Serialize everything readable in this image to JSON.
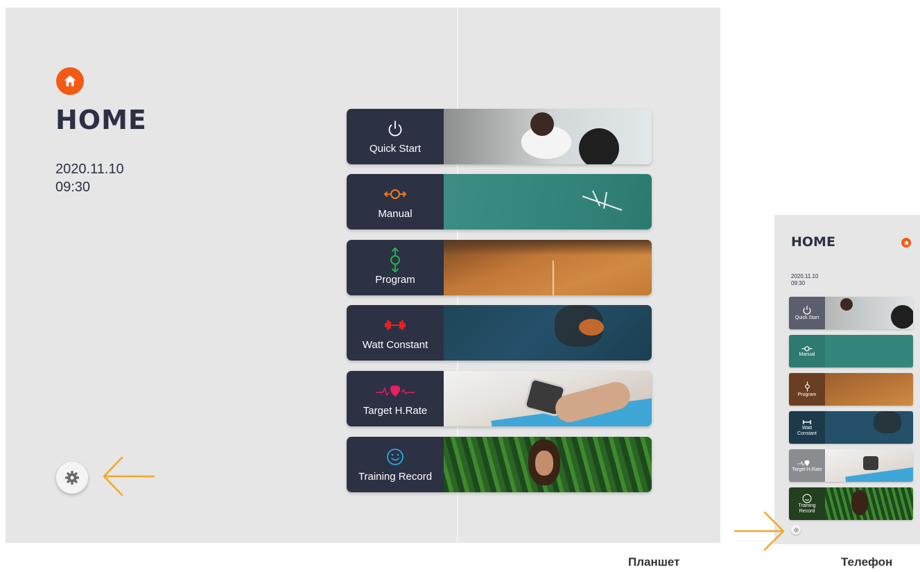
{
  "tablet": {
    "title": "HOME",
    "date": "2020.11.10",
    "time": "09:30",
    "home_icon": "home-icon",
    "settings_icon": "gear-icon",
    "menu": [
      {
        "label": "Quick Start",
        "icon": "power-icon"
      },
      {
        "label": "Manual",
        "icon": "manual-resistance-icon"
      },
      {
        "label": "Program",
        "icon": "program-icon"
      },
      {
        "label": "Watt Constant",
        "icon": "dumbbell-icon"
      },
      {
        "label": "Target H.Rate",
        "icon": "heart-rate-icon"
      },
      {
        "label": "Training Record",
        "icon": "smiley-icon"
      }
    ]
  },
  "phone": {
    "title": "HOME",
    "date": "2020.11.10",
    "time": "09:30",
    "menu": [
      {
        "label": "Quick Start"
      },
      {
        "label": "Manual"
      },
      {
        "label": "Program"
      },
      {
        "label": "Watt Constant"
      },
      {
        "label": "Target H.Rate"
      },
      {
        "label": "Training Record"
      }
    ]
  },
  "captions": {
    "tablet": "Планшет",
    "phone": "Телефон"
  },
  "colors": {
    "accent": "#f25a15",
    "panel_bg": "#e6e6e6",
    "card_label_bg": "#2c3144",
    "arrow": "#f5a623",
    "manual_icon": "#f07c1e",
    "program_icon": "#22b14c",
    "watt_icon": "#e8201f",
    "heart_icon": "#e91e63",
    "record_icon": "#2aa8e0"
  }
}
